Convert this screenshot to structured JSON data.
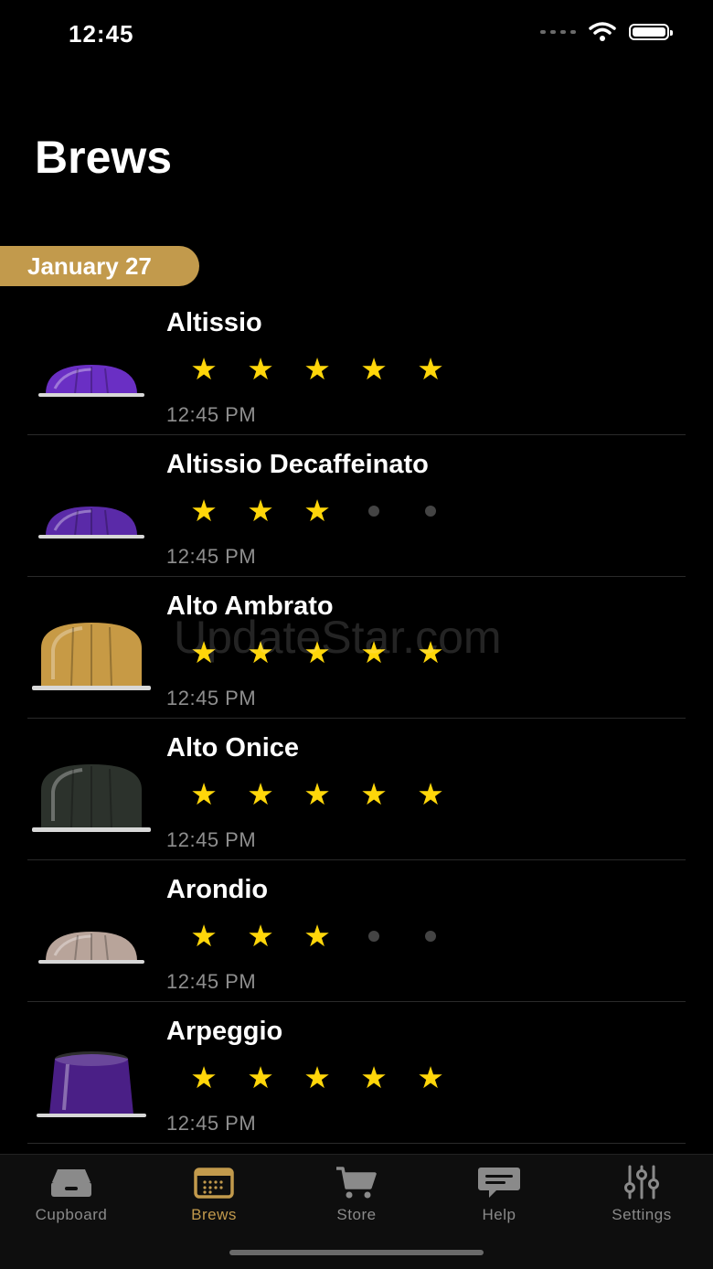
{
  "status_bar": {
    "time": "12:45"
  },
  "page": {
    "title": "Brews"
  },
  "section": {
    "date": "January 27"
  },
  "brews": [
    {
      "name": "Altissio",
      "rating": 5,
      "time": "12:45 PM",
      "pod_color": "#6a2fc4",
      "pod_shape": "dome"
    },
    {
      "name": "Altissio Decaffeinato",
      "rating": 3,
      "time": "12:45 PM",
      "pod_color": "#5a2aa8",
      "pod_shape": "dome"
    },
    {
      "name": "Alto Ambrato",
      "rating": 5,
      "time": "12:45 PM",
      "pod_color": "#c79a45",
      "pod_shape": "tall"
    },
    {
      "name": "Alto Onice",
      "rating": 5,
      "time": "12:45 PM",
      "pod_color": "#2c322c",
      "pod_shape": "tall"
    },
    {
      "name": "Arondio",
      "rating": 3,
      "time": "12:45 PM",
      "pod_color": "#b8a49a",
      "pod_shape": "dome"
    },
    {
      "name": "Arpeggio",
      "rating": 5,
      "time": "12:45 PM",
      "pod_color": "#4a1f86",
      "pod_shape": "cup"
    }
  ],
  "watermark": "UpdateStar.com",
  "tabs": [
    {
      "label": "Cupboard",
      "icon": "cupboard-icon",
      "active": false
    },
    {
      "label": "Brews",
      "icon": "brews-icon",
      "active": true
    },
    {
      "label": "Store",
      "icon": "cart-icon",
      "active": false
    },
    {
      "label": "Help",
      "icon": "chat-icon",
      "active": false
    },
    {
      "label": "Settings",
      "icon": "sliders-icon",
      "active": false
    }
  ],
  "colors": {
    "accent": "#c29a4c",
    "star": "#ffd60a",
    "background": "#000000"
  }
}
